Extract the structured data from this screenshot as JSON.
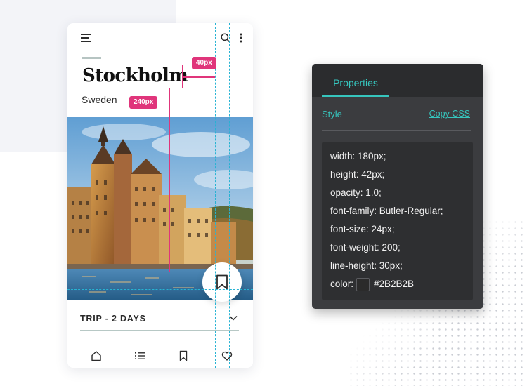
{
  "app": {
    "city": "Stockholm",
    "country": "Sweden",
    "trip_label": "TRIP - 2 DAYS"
  },
  "icons": {
    "menu": "hamburger-icon",
    "search": "search-icon",
    "more": "more-vertical-icon",
    "save": "bookmark-icon",
    "expand": "chevron-down-icon",
    "nav": [
      "home-icon",
      "list-icon",
      "bookmark-icon",
      "heart-icon"
    ]
  },
  "annotations": {
    "badge_spacing": "40px",
    "badge_offset": "240px",
    "guide_color": "#27B3D3",
    "marker_color": "#E0357B"
  },
  "properties_panel": {
    "tab": "Properties",
    "section": "Style",
    "copy_css": "Copy CSS",
    "css": [
      "width: 180px;",
      "height: 42px;",
      "opacity: 1.0;",
      "font-family: Butler-Regular;",
      "font-size: 24px;",
      "font-weight: 200;",
      "line-height: 30px;"
    ],
    "color_label": "color:",
    "color_value": "#2B2B2B",
    "accent_color": "#36C5BD"
  }
}
